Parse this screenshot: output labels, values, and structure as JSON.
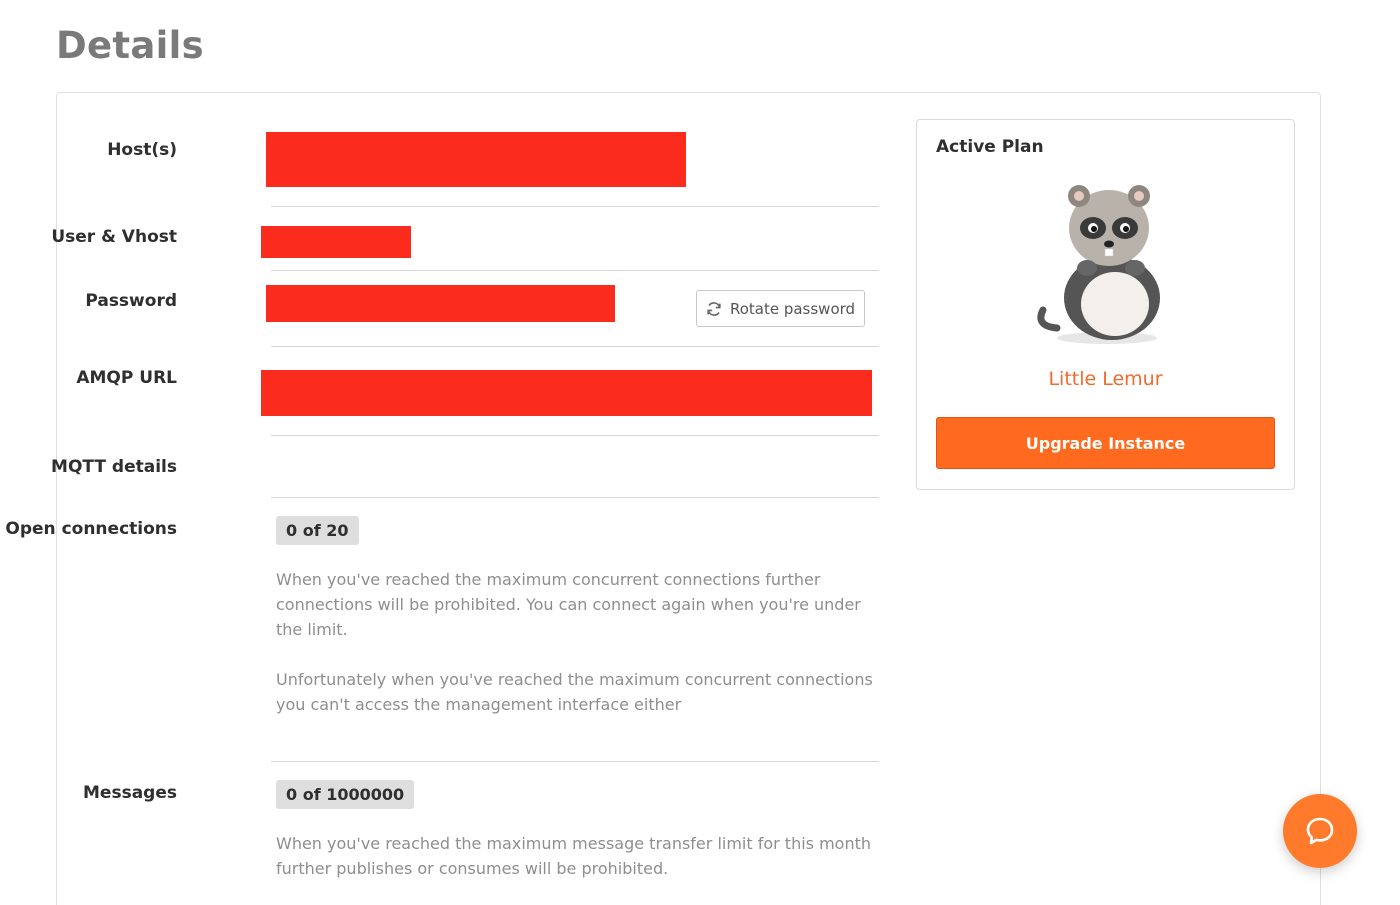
{
  "page": {
    "title": "Details"
  },
  "details": {
    "hosts_label": "Host(s)",
    "user_vhost_label": "User & Vhost",
    "password_label": "Password",
    "rotate_password_label": "Rotate password",
    "amqp_url_label": "AMQP URL",
    "mqtt_label": "MQTT details",
    "open_connections_label": "Open connections",
    "open_connections_value": "0 of 20",
    "open_connections_help_1": "When you've reached the maximum concurrent connections further connections will be prohibited. You can connect again when you're under the limit.",
    "open_connections_help_2": "Unfortunately when you've reached the maximum concurrent connections you can't access the management interface either",
    "messages_label": "Messages",
    "messages_value": "0 of 1000000",
    "messages_help": "When you've reached the maximum message transfer limit for this month further publishes or consumes will be prohibited."
  },
  "plan": {
    "title": "Active Plan",
    "name": "Little Lemur",
    "upgrade_label": "Upgrade Instance"
  },
  "colors": {
    "redaction": "#fb2c1e",
    "accent": "#ff6a1e",
    "plan_name": "#ef6a2b"
  },
  "icons": {
    "rotate": "refresh-icon",
    "chat": "chat-bubble-icon",
    "mascot": "lemur-mascot-image"
  }
}
